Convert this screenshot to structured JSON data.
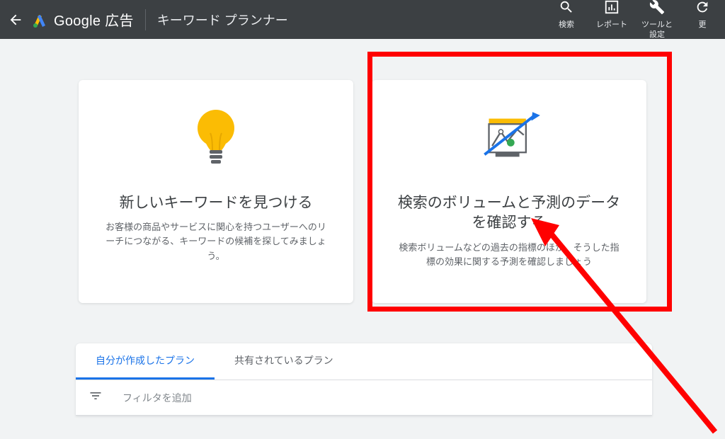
{
  "header": {
    "brand": "Google",
    "product": "広告",
    "pageTitle": "キーワード プランナー",
    "actions": {
      "search": "検索",
      "reports": "レポート",
      "toolsSettings": "ツールと\n設定",
      "more": "更"
    }
  },
  "cards": {
    "left": {
      "title": "新しいキーワードを見つける",
      "desc": "お客様の商品やサービスに関心を持つユーザーへのリーチにつながる、キーワードの候補を探してみましょう。"
    },
    "right": {
      "title": "検索のボリュームと予測のデータを確認する",
      "desc": "検索ボリュームなどの過去の指標のほか、そうした指標の効果に関する予測を確認しましょう"
    }
  },
  "tabs": {
    "mine": "自分が作成したプラン",
    "shared": "共有されているプラン"
  },
  "filter": {
    "addFilter": "フィルタを追加"
  }
}
